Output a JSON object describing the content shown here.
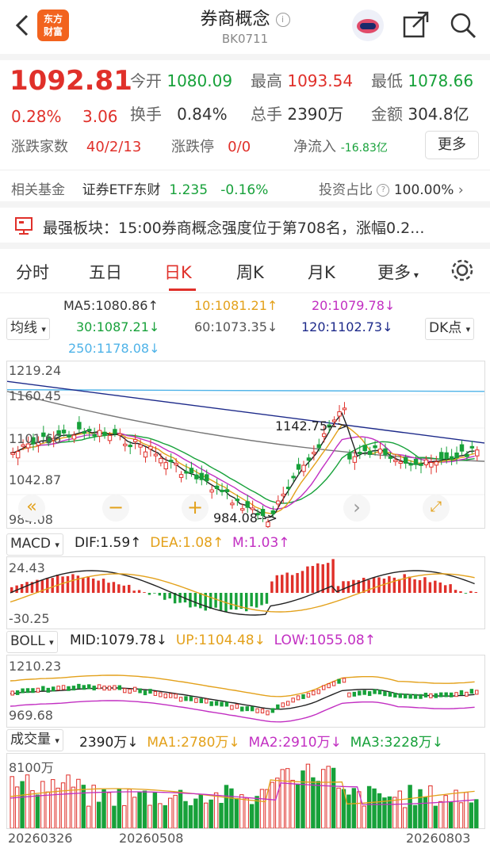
{
  "header": {
    "logo_text_1": "东方",
    "logo_text_2": "财富",
    "title": "券商概念",
    "code": "BK0711",
    "icons": [
      "back-arrow-icon",
      "info-icon",
      "avatar-robot-icon",
      "share-icon",
      "search-icon"
    ]
  },
  "quote": {
    "price": "1092.81",
    "change_pct": "0.28%",
    "change_amt": "3.06",
    "open_label": "今开",
    "open": "1080.09",
    "high_label": "最高",
    "high": "1093.54",
    "low_label": "最低",
    "low": "1078.66",
    "turnover_label": "换手",
    "turnover": "0.84%",
    "volume_label": "总手",
    "volume": "2390万",
    "amount_label": "金额",
    "amount": "304.8亿",
    "updown_label": "涨跌家数",
    "updown": "40/2/13",
    "limit_label": "涨跌停",
    "limit": "0/0",
    "netflow_label": "净流入",
    "netflow": "-16.83亿",
    "more": "更多"
  },
  "fund": {
    "label": "相关基金",
    "name": "证券ETF东财",
    "price": "1.235",
    "pct": "-0.16%",
    "ratio_label": "投资占比",
    "ratio": "100.00%"
  },
  "notice": {
    "text": "最强板块：15:00券商概念强度位于第708名，涨幅0.2..."
  },
  "tabs": [
    "分时",
    "五日",
    "日K",
    "周K",
    "月K",
    "更多"
  ],
  "ma_line": {
    "selector": "均线",
    "dk": "DK点",
    "ma5": "MA5:1080.86↑",
    "ma10": "10:1081.21↑",
    "ma20": "20:1079.78↓",
    "ma30": "30:1087.21↓",
    "ma60": "60:1073.35↓",
    "ma120": "120:1102.73↓",
    "ma250": "250:1178.08↓"
  },
  "kchart": {
    "y_labels": [
      "1219.24",
      "1160.45",
      "1101.66",
      "1042.87",
      "984.08"
    ],
    "peak_label": "1142.75",
    "low_label": "984.08"
  },
  "macd": {
    "selector": "MACD",
    "dif": "DIF:1.59↑",
    "dea": "DEA:1.08↑",
    "m": "M:1.03↑",
    "top": "24.43",
    "bottom": "-30.25"
  },
  "boll": {
    "selector": "BOLL",
    "mid": "MID:1079.78↓",
    "up": "UP:1104.48↓",
    "low": "LOW:1055.08↑",
    "top": "1210.23",
    "bottom": "969.68"
  },
  "vol": {
    "selector": "成交量",
    "value": "2390万↓",
    "ma1": "MA1:2780万↓",
    "ma2": "MA2:2910万↓",
    "ma3": "MA3:3228万↓",
    "top": "8100万"
  },
  "dates": [
    "20260326",
    "20260508",
    "20260803"
  ],
  "colors": {
    "up": "#e0302a",
    "down": "#17a13a",
    "accent": "#f2631e"
  }
}
